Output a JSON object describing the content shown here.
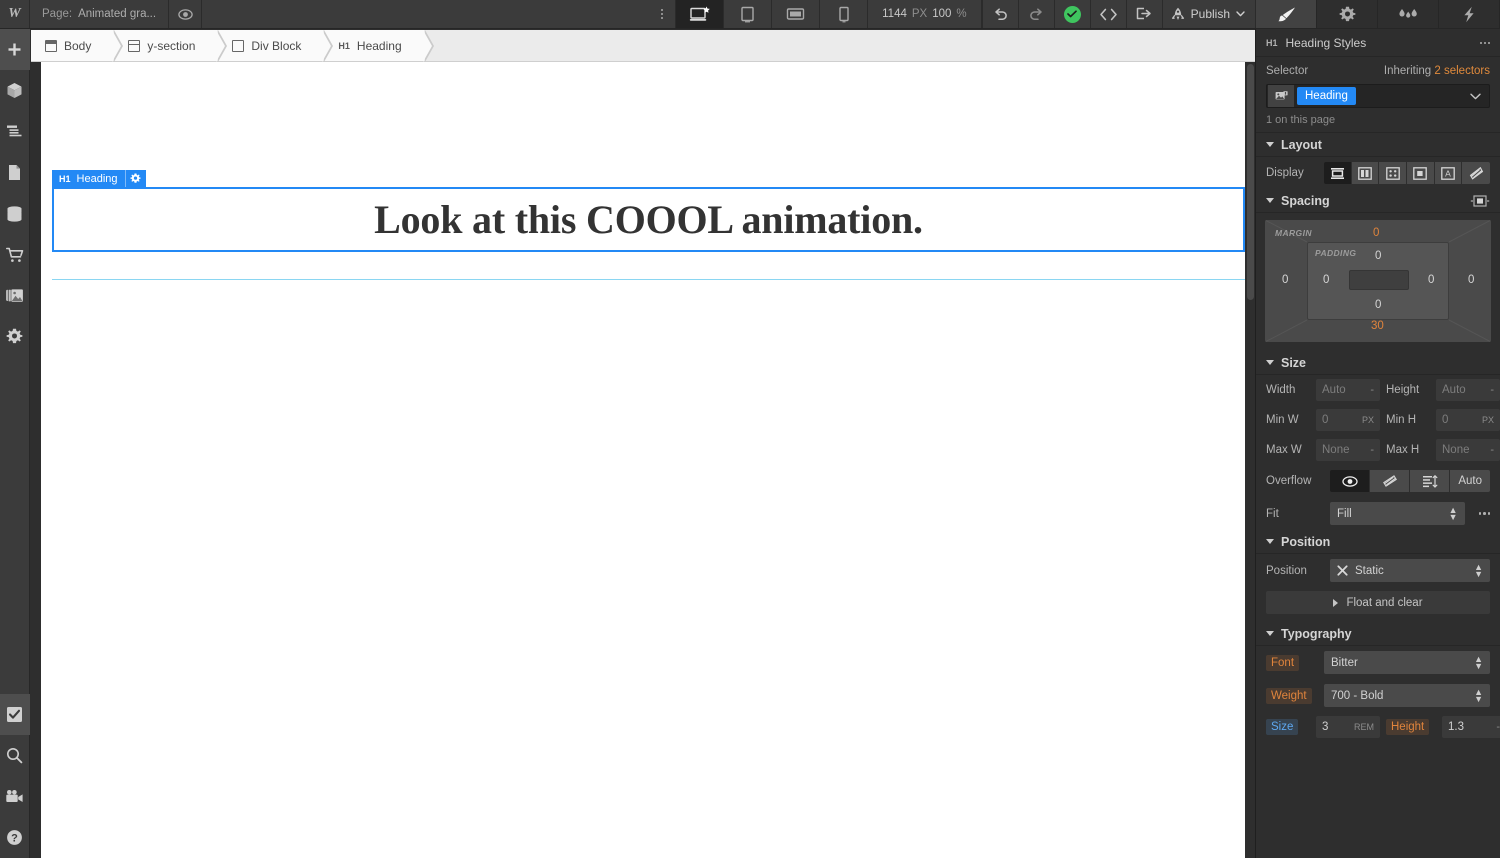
{
  "topbar": {
    "logo": "W",
    "page_key": "Page:",
    "page_name": "Animated gra...",
    "eye_icon": "eye-icon",
    "kebab_icon": "kebab-menu-icon",
    "devices": [
      {
        "name": "desktop",
        "icon": "desktop-icon",
        "active": true
      },
      {
        "name": "tablet",
        "icon": "tablet-icon",
        "active": false
      },
      {
        "name": "mobile-landscape",
        "icon": "mobile-landscape-icon",
        "active": false
      },
      {
        "name": "mobile-portrait",
        "icon": "mobile-portrait-icon",
        "active": false
      }
    ],
    "width_value": "1144",
    "width_unit": "PX",
    "zoom_value": "100",
    "zoom_unit": "%",
    "undo_icon": "undo-icon",
    "redo_icon": "redo-icon",
    "status_icon": "saved-check-icon",
    "code_icon": "code-brackets-icon",
    "share_icon": "share-export-icon",
    "rocket_icon": "rocket-icon",
    "publish_label": "Publish",
    "publish_caret": "chevron-down-icon",
    "panel_tabs": [
      {
        "name": "style",
        "icon": "paintbrush-icon",
        "active": true
      },
      {
        "name": "settings",
        "icon": "gear-icon",
        "active": false
      },
      {
        "name": "interactions",
        "icon": "droplets-icon",
        "active": false
      },
      {
        "name": "effects",
        "icon": "lightning-bolt-icon",
        "active": false
      }
    ]
  },
  "sidebar": {
    "items": [
      {
        "name": "add-elements",
        "icon": "plus-icon",
        "active": true
      },
      {
        "name": "components",
        "icon": "cube-icon",
        "active": false
      },
      {
        "name": "navigator",
        "icon": "navigator-lines-icon",
        "active": false
      },
      {
        "name": "pages",
        "icon": "page-icon",
        "active": false
      },
      {
        "name": "cms",
        "icon": "database-icon",
        "active": false
      },
      {
        "name": "ecommerce",
        "icon": "shopping-cart-icon",
        "active": false
      },
      {
        "name": "assets",
        "icon": "images-icon",
        "active": false
      },
      {
        "name": "settings",
        "icon": "gear-icon",
        "active": false
      }
    ],
    "bottom_items": [
      {
        "name": "audit",
        "icon": "checkbox-check-icon",
        "active": true
      },
      {
        "name": "search",
        "icon": "magnifier-icon",
        "active": false
      },
      {
        "name": "video-tutorials",
        "icon": "video-camera-icon",
        "active": false
      },
      {
        "name": "help",
        "icon": "question-mark-icon",
        "active": false
      }
    ]
  },
  "breadcrumb": [
    {
      "label": "Body",
      "icon": "body-icon"
    },
    {
      "label": "y-section",
      "icon": "section-icon"
    },
    {
      "label": "Div Block",
      "icon": "div-block-icon"
    },
    {
      "label": "Heading",
      "icon": "h1-icon"
    }
  ],
  "canvas": {
    "element_badge": {
      "tag": "H1",
      "label": "Heading",
      "gear_icon": "gear-icon"
    },
    "heading_text": "Look at this COOOL animation."
  },
  "right_panel": {
    "title": "Heading Styles",
    "title_tag": "H1",
    "more_icon": "more-options-icon",
    "selector": {
      "label": "Selector",
      "inheriting_prefix": "Inheriting ",
      "inheriting_count": "2 selectors",
      "class_icon": "class-swatch-icon",
      "class_tag": "Heading",
      "caret_icon": "chevron-down-icon",
      "note": "1 on this page"
    },
    "layout": {
      "title": "Layout",
      "display_label": "Display",
      "display_options": [
        {
          "name": "block",
          "icon": "display-block-icon",
          "active": true
        },
        {
          "name": "flex",
          "icon": "display-flex-icon",
          "active": false
        },
        {
          "name": "grid",
          "icon": "display-grid-icon",
          "active": false
        },
        {
          "name": "inline-block",
          "icon": "display-inline-block-icon",
          "active": false
        },
        {
          "name": "inline",
          "icon": "display-inline-icon",
          "active": false
        },
        {
          "name": "none",
          "icon": "display-none-icon",
          "active": false
        }
      ]
    },
    "spacing": {
      "title": "Spacing",
      "mode_icon": "spacing-mode-icon",
      "margin_label": "MARGIN",
      "padding_label": "PADDING",
      "margin": {
        "top": "0",
        "right": "0",
        "bottom": "30",
        "left": "0"
      },
      "padding": {
        "top": "0",
        "right": "0",
        "bottom": "0",
        "left": "0"
      }
    },
    "size": {
      "title": "Size",
      "width_label": "Width",
      "width_value": "Auto",
      "height_label": "Height",
      "height_value": "Auto",
      "minw_label": "Min W",
      "minw_value": "0",
      "minw_unit": "PX",
      "minh_label": "Min H",
      "minh_value": "0",
      "minh_unit": "PX",
      "maxw_label": "Max W",
      "maxw_value": "None",
      "maxh_label": "Max H",
      "maxh_value": "None",
      "overflow_label": "Overflow",
      "overflow_options": [
        {
          "name": "visible",
          "icon": "eye-icon",
          "active": true
        },
        {
          "name": "hidden",
          "icon": "eye-slash-icon",
          "active": false
        },
        {
          "name": "scroll",
          "icon": "scroll-icon",
          "active": false
        }
      ],
      "overflow_auto": "Auto",
      "fit_label": "Fit",
      "fit_value": "Fill",
      "fit_more_icon": "more-options-icon"
    },
    "position": {
      "title": "Position",
      "label": "Position",
      "clear_icon": "close-x-icon",
      "value": "Static",
      "float_label": "Float and clear",
      "float_caret": "chevron-right-icon"
    },
    "typography": {
      "title": "Typography",
      "font_label": "Font",
      "font_value": "Bitter",
      "weight_label": "Weight",
      "weight_value": "700 - Bold",
      "size_label": "Size",
      "size_value": "3",
      "size_unit": "REM",
      "height_label": "Height",
      "height_value": "1.3"
    }
  },
  "colors": {
    "accent_blue": "#2389f5",
    "orange": "#e0843c",
    "green": "#3fc55f",
    "panel_bg": "#2e2e2e",
    "toolbar_bg": "#3b3b3b"
  }
}
